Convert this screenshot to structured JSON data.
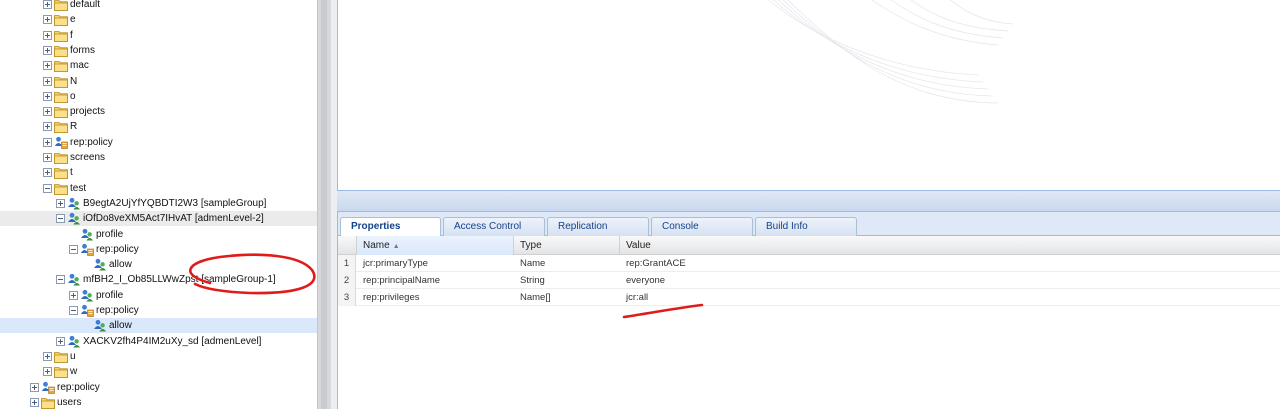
{
  "tree": {
    "rows": [
      {
        "id": "default",
        "label": "default",
        "depth": 2,
        "toggle": "plus",
        "icon": "folder-icon"
      },
      {
        "id": "e",
        "label": "e",
        "depth": 2,
        "toggle": "plus",
        "icon": "folder-icon"
      },
      {
        "id": "f",
        "label": "f",
        "depth": 2,
        "toggle": "plus",
        "icon": "folder-icon"
      },
      {
        "id": "forms",
        "label": "forms",
        "depth": 2,
        "toggle": "plus",
        "icon": "folder-icon"
      },
      {
        "id": "mac",
        "label": "mac",
        "depth": 2,
        "toggle": "plus",
        "icon": "folder-icon"
      },
      {
        "id": "N",
        "label": "N",
        "depth": 2,
        "toggle": "plus",
        "icon": "folder-icon"
      },
      {
        "id": "o",
        "label": "o",
        "depth": 2,
        "toggle": "plus",
        "icon": "folder-icon"
      },
      {
        "id": "projects",
        "label": "projects",
        "depth": 2,
        "toggle": "plus",
        "icon": "folder-icon"
      },
      {
        "id": "R",
        "label": "R",
        "depth": 2,
        "toggle": "plus",
        "icon": "folder-icon"
      },
      {
        "id": "rep-policy-1",
        "label": "rep:policy",
        "depth": 2,
        "toggle": "plus",
        "icon": "policy-icon"
      },
      {
        "id": "screens",
        "label": "screens",
        "depth": 2,
        "toggle": "plus",
        "icon": "folder-icon"
      },
      {
        "id": "t",
        "label": "t",
        "depth": 2,
        "toggle": "plus",
        "icon": "folder-icon"
      },
      {
        "id": "test",
        "label": "test",
        "depth": 2,
        "toggle": "minus",
        "icon": "folder-icon"
      },
      {
        "id": "b9eg",
        "label": "B9egtA2UjYfYQBDTI2W3 [sampleGroup]",
        "depth": 3,
        "toggle": "plus",
        "icon": "group-icon"
      },
      {
        "id": "iofdo",
        "label": "iOfDo8veXM5Act7IHvAT [admenLevel-2]",
        "depth": 3,
        "toggle": "minus",
        "icon": "group-icon",
        "selected": "light"
      },
      {
        "id": "profile-1",
        "label": "profile",
        "depth": 4,
        "toggle": "none",
        "icon": "group-icon"
      },
      {
        "id": "rep-policy-2",
        "label": "rep:policy",
        "depth": 4,
        "toggle": "minus",
        "icon": "policy-icon"
      },
      {
        "id": "allow-1",
        "label": "allow",
        "depth": 5,
        "toggle": "none",
        "icon": "group-icon"
      },
      {
        "id": "mfbh2",
        "label": "mfBH2_I_Ob85LLWwZpst [sampleGroup-1]",
        "depth": 3,
        "toggle": "minus",
        "icon": "group-icon"
      },
      {
        "id": "profile-2",
        "label": "profile",
        "depth": 4,
        "toggle": "plus",
        "icon": "group-icon"
      },
      {
        "id": "rep-policy-3",
        "label": "rep:policy",
        "depth": 4,
        "toggle": "minus",
        "icon": "policy-icon"
      },
      {
        "id": "allow-2",
        "label": "allow",
        "depth": 5,
        "toggle": "none",
        "icon": "group-icon",
        "selected": "blue"
      },
      {
        "id": "xackv",
        "label": "XACKV2fh4P4IM2uXy_sd [admenLevel]",
        "depth": 3,
        "toggle": "plus",
        "icon": "group-icon"
      },
      {
        "id": "u",
        "label": "u",
        "depth": 2,
        "toggle": "plus",
        "icon": "folder-icon"
      },
      {
        "id": "w",
        "label": "w",
        "depth": 2,
        "toggle": "plus",
        "icon": "folder-icon"
      },
      {
        "id": "rep-policy-4",
        "label": "rep:policy",
        "depth": 1,
        "toggle": "plus",
        "icon": "policy-icon"
      },
      {
        "id": "users",
        "label": "users",
        "depth": 1,
        "toggle": "plus",
        "icon": "folder-icon"
      }
    ]
  },
  "tabs": [
    {
      "label": "Properties",
      "active": true
    },
    {
      "label": "Access Control",
      "active": false
    },
    {
      "label": "Replication",
      "active": false
    },
    {
      "label": "Console",
      "active": false
    },
    {
      "label": "Build Info",
      "active": false
    }
  ],
  "grid": {
    "headers": {
      "name": "Name",
      "type": "Type",
      "value": "Value"
    },
    "sort_indicator": "▲",
    "rows": [
      {
        "num": "1",
        "name": "jcr:primaryType",
        "type": "Name",
        "value": "rep:GrantACE"
      },
      {
        "num": "2",
        "name": "rep:principalName",
        "type": "String",
        "value": "everyone"
      },
      {
        "num": "3",
        "name": "rep:privileges",
        "type": "Name[]",
        "value": "jcr:all"
      }
    ]
  },
  "colors": {
    "panel_border": "#99bbe8",
    "tab_text": "#15428b",
    "annotation_red": "#e01b1b",
    "selected_row": "#d9e8fb"
  }
}
